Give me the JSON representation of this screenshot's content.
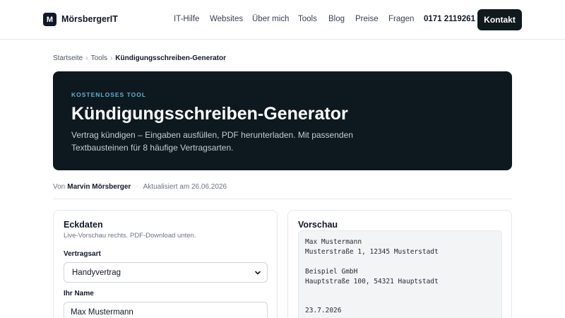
{
  "header": {
    "logo_letter": "M",
    "logo_text": "MörsbergerIT",
    "nav": [
      "IT-Hilfe",
      "Websites",
      "Über mich",
      "Tools",
      "Blog",
      "Preise",
      "Fragen"
    ],
    "phone": "0171 2119261",
    "cta_label": "Kontakt"
  },
  "breadcrumb": {
    "items": [
      "Startseite",
      "Tools"
    ],
    "separator": "›",
    "current": "Kündigungsschreiben-Generator"
  },
  "hero": {
    "eyebrow": "KOSTENLOSES TOOL",
    "title": "Kündigungsschreiben-Generator",
    "description": "Vertrag kündigen – Eingaben ausfüllen, PDF herunterladen. Mit passenden Textbausteinen für 8 häufige Vertragsarten."
  },
  "meta": {
    "by_label": "Von",
    "author": "Marvin Mörsberger",
    "separator": "·",
    "updated": "Aktualisiert am 26.06.2026"
  },
  "form": {
    "title": "Eckdaten",
    "subtitle": "Live-Vorschau rechts. PDF-Download unten.",
    "contract_type_label": "Vertragsart",
    "contract_type_value": "Handyvertrag",
    "name_label": "Ihr Name",
    "name_value": "Max Mustermann"
  },
  "preview": {
    "title": "Vorschau",
    "lines": [
      "Max Mustermann",
      "Musterstraße 1, 12345 Musterstadt",
      "",
      "Beispiel GmbH",
      "Hauptstraße 100, 54321 Hauptstadt",
      "",
      "",
      "23.7.2026"
    ]
  },
  "colors": {
    "hero_bg": "#0d191f",
    "eyebrow": "#5fb0d2",
    "cta_bg": "#0f1a1f"
  }
}
